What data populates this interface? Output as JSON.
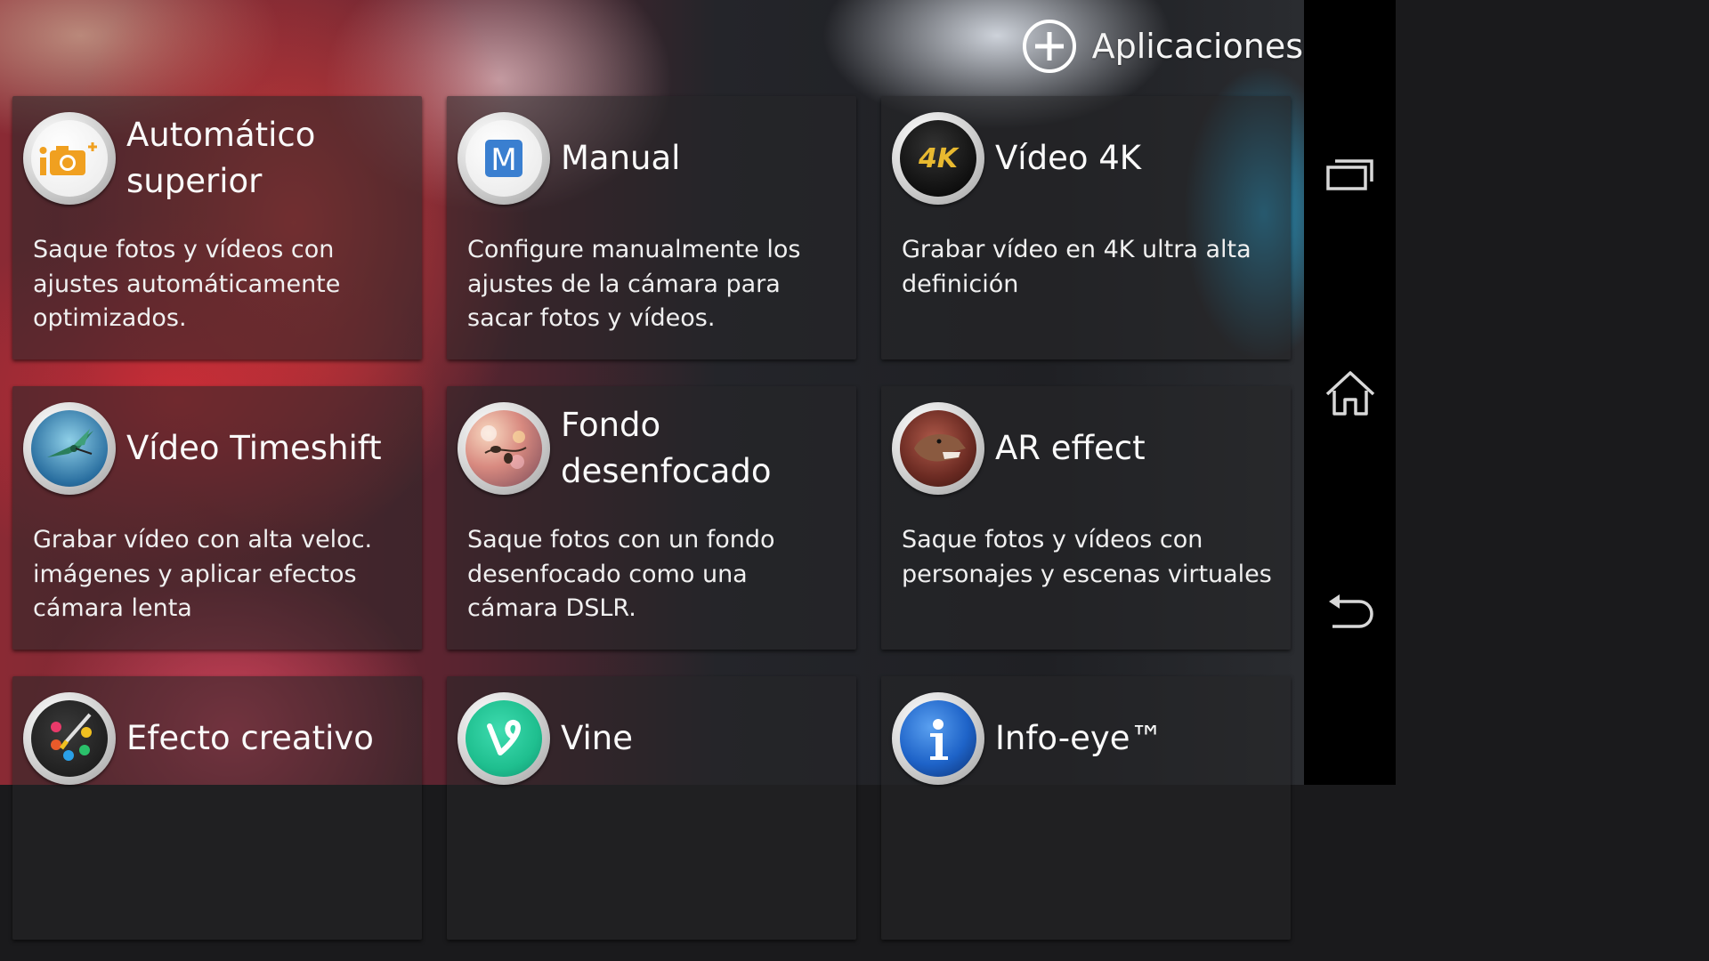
{
  "header": {
    "applications_label": "Aplicaciones"
  },
  "cards": [
    {
      "title": "Automático superior",
      "description": "Saque fotos y vídeos con ajustes automáticamente optimizados.",
      "icon": "superior-auto-icon"
    },
    {
      "title": "Manual",
      "description": "Configure manualmente los ajustes de la cámara para sacar fotos y vídeos.",
      "icon": "manual-m-icon"
    },
    {
      "title": "Vídeo 4K",
      "description": "Grabar vídeo en 4K ultra alta definición",
      "icon": "4k-video-icon",
      "badge": "4K"
    },
    {
      "title": "Vídeo Timeshift",
      "description": "Grabar vídeo con alta veloc. imágenes y aplicar efectos cámara lenta",
      "icon": "hummingbird-icon"
    },
    {
      "title": "Fondo desenfocado",
      "description": "Saque fotos con un fondo desenfocado como una cámara DSLR.",
      "icon": "background-defocus-icon"
    },
    {
      "title": "AR effect",
      "description": "Saque fotos y vídeos con personajes y escenas virtuales",
      "icon": "dinosaur-icon"
    },
    {
      "title": "Efecto creativo",
      "description": "",
      "icon": "paint-palette-icon"
    },
    {
      "title": "Vine",
      "description": "",
      "icon": "vine-logo-icon"
    },
    {
      "title": "Info-eye™",
      "description": "",
      "icon": "info-icon"
    }
  ],
  "navbar": {
    "recent_apps_icon": "recent-apps-icon",
    "home_icon": "home-icon",
    "back_icon": "back-icon"
  },
  "colors": {
    "vine_green": "#1fbf8f",
    "info_blue": "#1e63c8",
    "superior_orange": "#f0a020",
    "manual_blue": "#3a7fd0"
  }
}
